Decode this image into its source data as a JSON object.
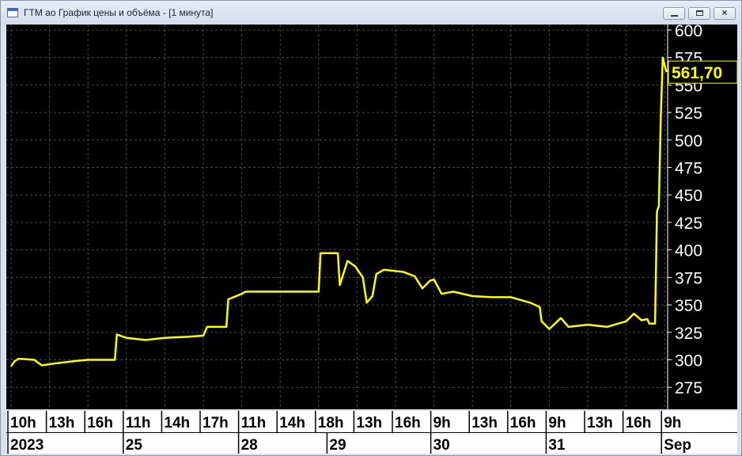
{
  "window": {
    "title": "ГТМ ао График цены и объёма - [1 минута]",
    "buttons": {
      "close_glyph": "×"
    }
  },
  "colors": {
    "background": "#000000",
    "line": "#ffff00",
    "grid": "#4a4a4a",
    "axis_text": "#ffffff",
    "axis_bg": "#ffffff",
    "time_text": "#000000"
  },
  "chart_data": {
    "type": "line",
    "title": "",
    "ylim": [
      255,
      605
    ],
    "y_ticks": [
      600,
      575,
      550,
      525,
      500,
      475,
      450,
      425,
      400,
      375,
      350,
      325,
      300,
      275
    ],
    "y_tick_labels": [
      "600",
      "575",
      "550",
      "525",
      "500",
      "475",
      "450",
      "425",
      "400",
      "375",
      "350",
      "325",
      "300",
      "275"
    ],
    "last_price_label": "561,70",
    "last_price": 561.7,
    "grid": true,
    "x_ticks": [
      {
        "label": "10h",
        "i": 0
      },
      {
        "label": "13h",
        "i": 1
      },
      {
        "label": "16h",
        "i": 2
      },
      {
        "label": "11h",
        "i": 3
      },
      {
        "label": "14h",
        "i": 4
      },
      {
        "label": "17h",
        "i": 5
      },
      {
        "label": "11h",
        "i": 6
      },
      {
        "label": "14h",
        "i": 7
      },
      {
        "label": "18h",
        "i": 8
      },
      {
        "label": "13h",
        "i": 9
      },
      {
        "label": "16h",
        "i": 10
      },
      {
        "label": "9h",
        "i": 11
      },
      {
        "label": "13h",
        "i": 12
      },
      {
        "label": "16h",
        "i": 13
      },
      {
        "label": "9h",
        "i": 14
      },
      {
        "label": "13h",
        "i": 15
      },
      {
        "label": "16h",
        "i": 16
      },
      {
        "label": "9h",
        "i": 17
      }
    ],
    "date_labels": [
      {
        "label": "2023",
        "i": 0
      },
      {
        "label": "25",
        "i": 3
      },
      {
        "label": "28",
        "i": 6
      },
      {
        "label": "29",
        "i": 8.3
      },
      {
        "label": "30",
        "i": 11
      },
      {
        "label": "31",
        "i": 14
      },
      {
        "label": "Sep",
        "i": 17
      }
    ],
    "series": [
      {
        "points": [
          [
            0,
            294
          ],
          [
            0.1,
            299
          ],
          [
            0.2,
            301
          ],
          [
            0.6,
            300
          ],
          [
            0.8,
            295
          ],
          [
            1.2,
            297
          ],
          [
            1.7,
            299
          ],
          [
            2.0,
            300
          ],
          [
            2.7,
            300
          ],
          [
            2.75,
            323
          ],
          [
            3.0,
            320
          ],
          [
            3.5,
            318
          ],
          [
            4.0,
            320
          ],
          [
            4.6,
            321
          ],
          [
            5.0,
            322
          ],
          [
            5.1,
            330
          ],
          [
            5.6,
            330
          ],
          [
            5.65,
            355
          ],
          [
            6.0,
            360
          ],
          [
            6.1,
            362
          ],
          [
            8.0,
            362
          ],
          [
            8.05,
            397
          ],
          [
            8.5,
            397
          ],
          [
            8.55,
            368
          ],
          [
            8.75,
            390
          ],
          [
            8.95,
            385
          ],
          [
            9.15,
            375
          ],
          [
            9.25,
            352
          ],
          [
            9.4,
            358
          ],
          [
            9.5,
            378
          ],
          [
            9.7,
            382
          ],
          [
            10.2,
            380
          ],
          [
            10.5,
            376
          ],
          [
            10.7,
            365
          ],
          [
            10.9,
            372
          ],
          [
            11.0,
            373
          ],
          [
            11.2,
            360
          ],
          [
            11.5,
            362
          ],
          [
            12.0,
            358
          ],
          [
            12.5,
            357
          ],
          [
            13.0,
            357
          ],
          [
            13.5,
            352
          ],
          [
            13.75,
            348
          ],
          [
            13.8,
            335
          ],
          [
            14.0,
            328
          ],
          [
            14.3,
            338
          ],
          [
            14.5,
            330
          ],
          [
            15.0,
            332
          ],
          [
            15.5,
            330
          ],
          [
            15.8,
            333
          ],
          [
            16.0,
            335
          ],
          [
            16.2,
            342
          ],
          [
            16.4,
            336
          ],
          [
            16.55,
            337
          ],
          [
            16.6,
            333
          ],
          [
            16.75,
            333
          ],
          [
            16.8,
            435
          ],
          [
            16.85,
            440
          ],
          [
            16.9,
            520
          ],
          [
            16.95,
            575
          ],
          [
            17.0,
            568
          ],
          [
            17.05,
            561.7
          ]
        ]
      }
    ]
  }
}
